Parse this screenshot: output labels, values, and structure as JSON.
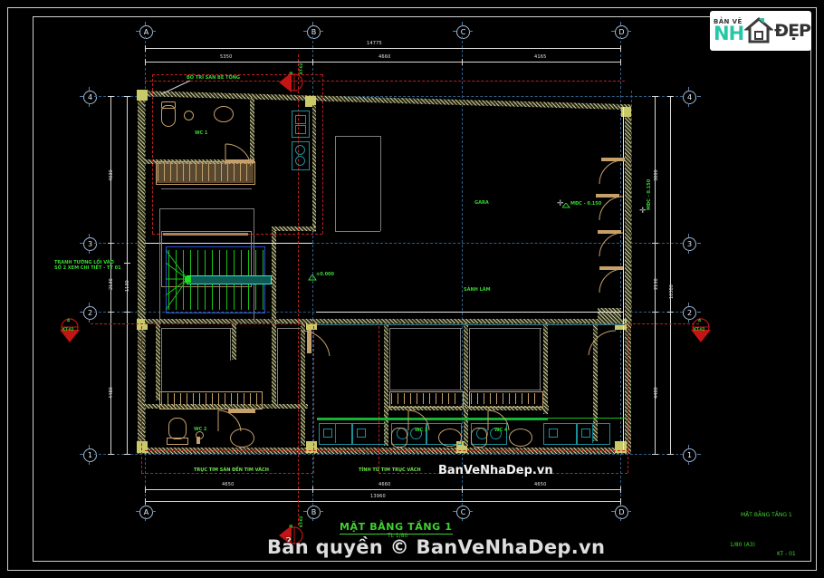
{
  "document": {
    "title": "MẶT BẰNG TẦNG 1",
    "title_sub": "TL 1/80",
    "sheet_label": "MẶT BẰNG TẦNG 1",
    "scale": "1/80  (A3)",
    "sheet_code": "KT - 01"
  },
  "branding": {
    "logo_top": "BẢN VẼ",
    "logo_main": "NH",
    "logo_tail": "ĐẸP",
    "logo_icon": "house-icon",
    "watermark_main": "Bản quyền © BanVeNhaDep.vn",
    "watermark_secondary": "BanVeNhaDep.vn"
  },
  "grid": {
    "horizontal_labels": [
      "A",
      "B",
      "C",
      "D"
    ],
    "vertical_labels": [
      "1",
      "2",
      "3",
      "4"
    ]
  },
  "dimensions": {
    "top_total": "14775",
    "top_segments": [
      "5350",
      "4660",
      "4165"
    ],
    "bottom_total": "13960",
    "bottom_segments": [
      "4650",
      "4660",
      "4650"
    ],
    "left_segments": [
      "4030",
      "2130",
      "4480"
    ],
    "left_sub": [
      "1130"
    ],
    "right_segments": [
      "3800",
      "2130",
      "4480"
    ],
    "right_total": "10380"
  },
  "annotations": {
    "note_top": "BỐ TRÍ SÀN BÊ TÔNG",
    "note_left": "TRANH TƯỜNG LỐI VÀO SỐ 2 XEM CHI TIẾT - TT 01",
    "note_bottom_left": "TRỤC TIM SÀN ĐẾN TIM VÁCH",
    "note_bottom_mid": "TÍNH TỪ TIM TRỤC VÁCH",
    "level_center": "±0.000",
    "level_right": "MĐC - 0.150",
    "room_wc1": "WC 1",
    "room_wc2": "WC 2",
    "room_wc3": "WC 3",
    "room_wc4": "WC 4",
    "room_garage": "GARA",
    "room_living": "SẢNH LÀM"
  },
  "section_markers": [
    {
      "id": "marker-top",
      "label_top": "B",
      "label_bottom": "KT-02"
    },
    {
      "id": "marker-left",
      "label_top": "A",
      "label_bottom": "KT-02"
    },
    {
      "id": "marker-right",
      "label_top": "A",
      "label_bottom": "KT-02"
    },
    {
      "id": "marker-bottom",
      "label_top": "B",
      "label_bottom": "KT-02"
    }
  ],
  "colors": {
    "background": "#000000",
    "frame": "#cfcfcf",
    "grid": "#2f5f86",
    "annotation_green": "#38d430",
    "section_red": "#c02020",
    "wall": "#d9d9d9",
    "accent_teal": "#26c6a6"
  }
}
